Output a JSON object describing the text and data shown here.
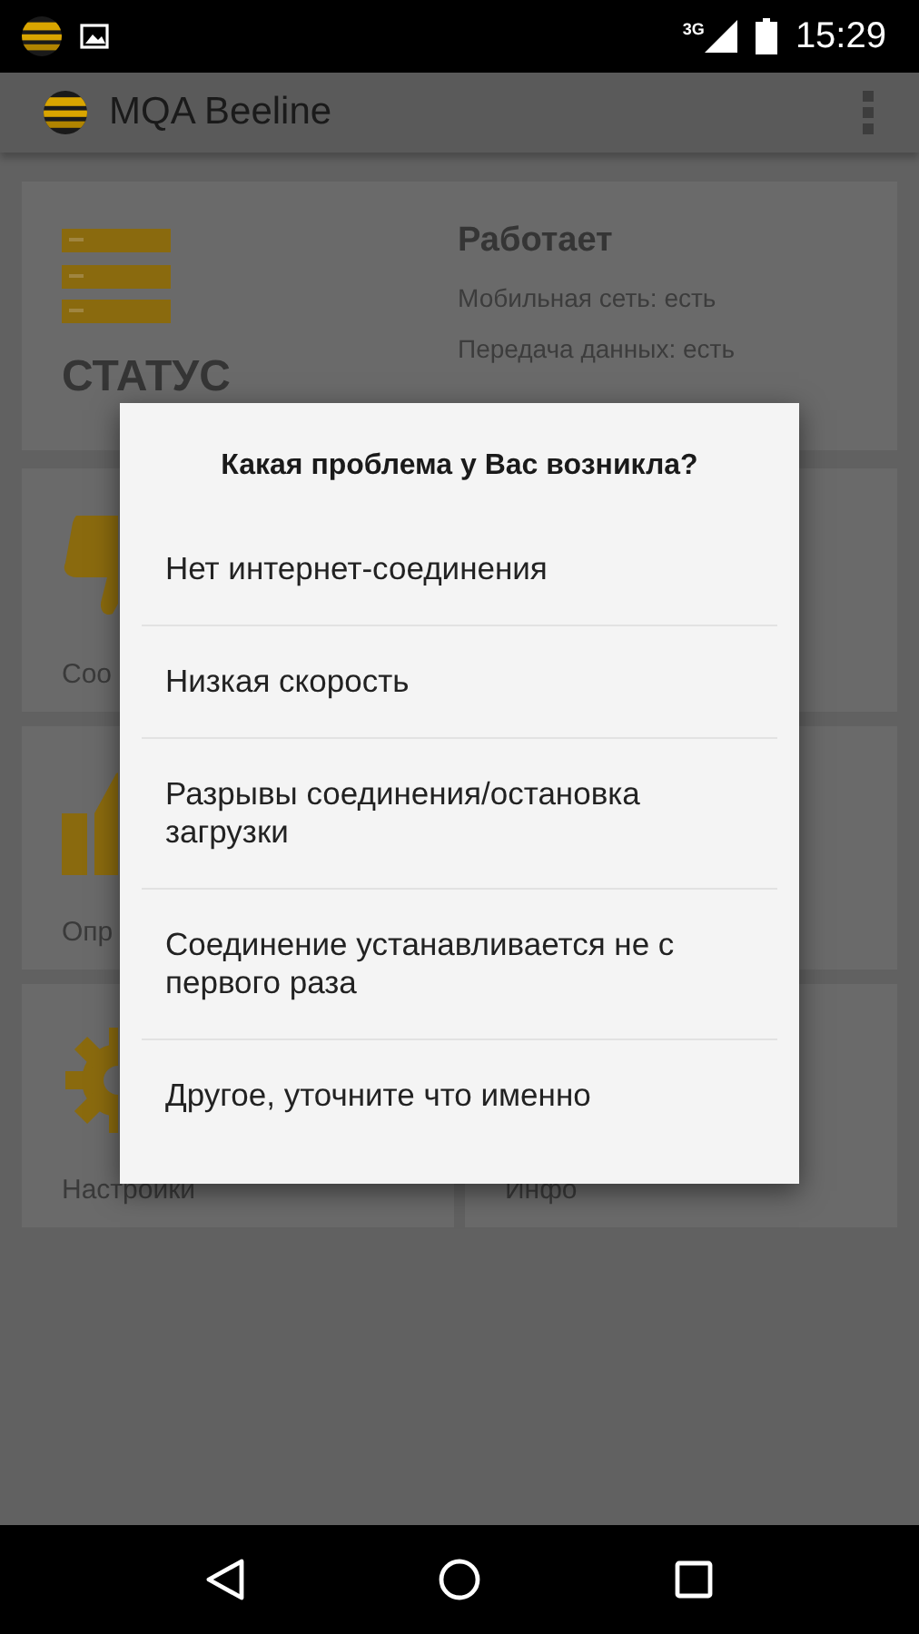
{
  "status_bar": {
    "network": "3G",
    "time": "15:29"
  },
  "app_bar": {
    "title": "MQA Beeline"
  },
  "status_card": {
    "heading": "СТАТУС",
    "state": "Работает",
    "lines": [
      "Мобильная сеть: есть",
      "Передача данных: есть"
    ]
  },
  "tiles": [
    {
      "kind": "thumbs-down",
      "label": "Соо"
    },
    {
      "kind": "none"
    },
    {
      "kind": "thumbs-up",
      "label": "Опр"
    },
    {
      "kind": "none"
    },
    {
      "kind": "gear",
      "label": "Настройки"
    },
    {
      "kind": "none",
      "label": "Инфо"
    }
  ],
  "dialog": {
    "title": "Какая проблема у Вас возникла?",
    "options": [
      "Нет интернет-соединения",
      "Низкая скорость",
      "Разрывы соединения/остановка загрузки",
      "Соединение устанавливается не с первого раза",
      "Другое, уточните что именно"
    ]
  }
}
